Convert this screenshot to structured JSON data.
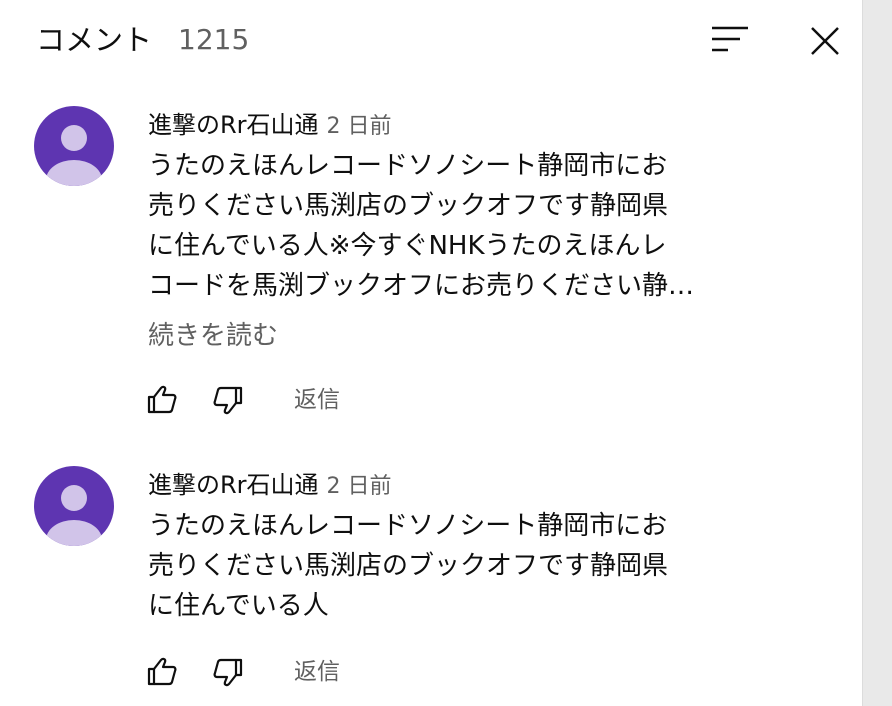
{
  "header": {
    "title": "コメント",
    "count": "1215"
  },
  "icons": {
    "sort": "sort-icon",
    "close": "close-icon",
    "like": "thumbs-up-icon",
    "dislike": "thumbs-down-icon",
    "avatar": "default-avatar-icon"
  },
  "colors": {
    "avatar_bg": "#5e35b1",
    "avatar_fg": "#d1c4e9",
    "secondary_text": "#606060"
  },
  "comments": [
    {
      "author": "進撃のRr石山通",
      "time": "2 日前",
      "lines": [
        "うたのえほんレコードソノシート静岡市にお",
        "売りください馬渕店のブックオフです静岡県",
        "に住んでいる人※今すぐNHKうたのえほんレ",
        "コードを馬渕ブックオフにお売りください静…"
      ],
      "read_more": "続きを読む",
      "reply": "返信"
    },
    {
      "author": "進撃のRr石山通",
      "time": "2 日前",
      "lines": [
        "うたのえほんレコードソノシート静岡市にお",
        "売りください馬渕店のブックオフです静岡県",
        "に住んでいる人"
      ],
      "reply": "返信"
    }
  ]
}
